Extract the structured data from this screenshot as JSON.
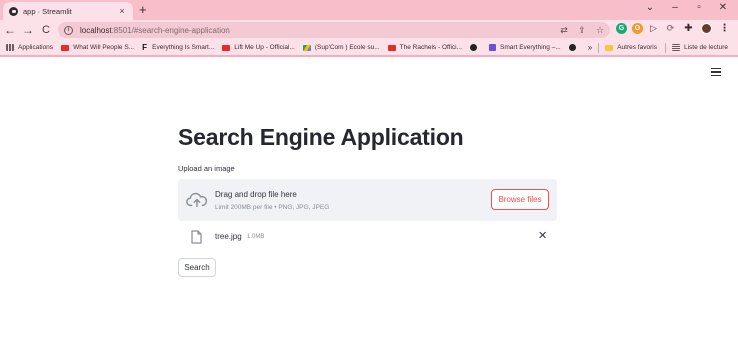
{
  "browser": {
    "tab_title": "app · Streamlit",
    "tab_close": "×",
    "new_tab": "+",
    "window_controls": {
      "chevron": "⌄",
      "minimize": "–",
      "maximize": "▫",
      "close": "✕"
    },
    "nav": {
      "back": "←",
      "forward": "→",
      "reload": "C"
    },
    "url_host": "localhost",
    "url_rest": ":8501/#search-engine-application",
    "omnibox_icons": [
      "translate-icon",
      "share-icon",
      "star-icon"
    ],
    "bookmarks": [
      {
        "label": "Applications",
        "icon": "apps-grid-icon"
      },
      {
        "label": "What Will People S...",
        "icon": "youtube-icon"
      },
      {
        "label": "Everything Is Smart...",
        "icon": "f-logo-icon"
      },
      {
        "label": "Lift Me Up - Official...",
        "icon": "youtube-icon"
      },
      {
        "label": "(Sup'Com ) Ecole su...",
        "icon": "google-drive-icon"
      },
      {
        "label": "The Rachels - Offici...",
        "icon": "youtube-icon"
      },
      {
        "label": "",
        "icon": "globe-icon"
      },
      {
        "label": "Smart Everything –...",
        "icon": "s-logo-icon"
      },
      {
        "label": "",
        "icon": "globe-icon"
      }
    ],
    "bookmarks_more": "»",
    "other_favorites": "Autres favoris",
    "reading_list": "Liste de lecture"
  },
  "app": {
    "title": "Search Engine Application",
    "uploader": {
      "label": "Upload an image",
      "drop_title": "Drag and drop file here",
      "drop_subtitle": "Limit 200MB per file • PNG, JPG, JPEG",
      "browse_label": "Browse files"
    },
    "uploaded_file": {
      "name": "tree.jpg",
      "size": "1.0MB",
      "remove": "✕"
    },
    "search_label": "Search"
  },
  "colors": {
    "accent": "#ff4b4b",
    "chrome": "#fce2e8",
    "dropzone": "#f0f2f6"
  }
}
